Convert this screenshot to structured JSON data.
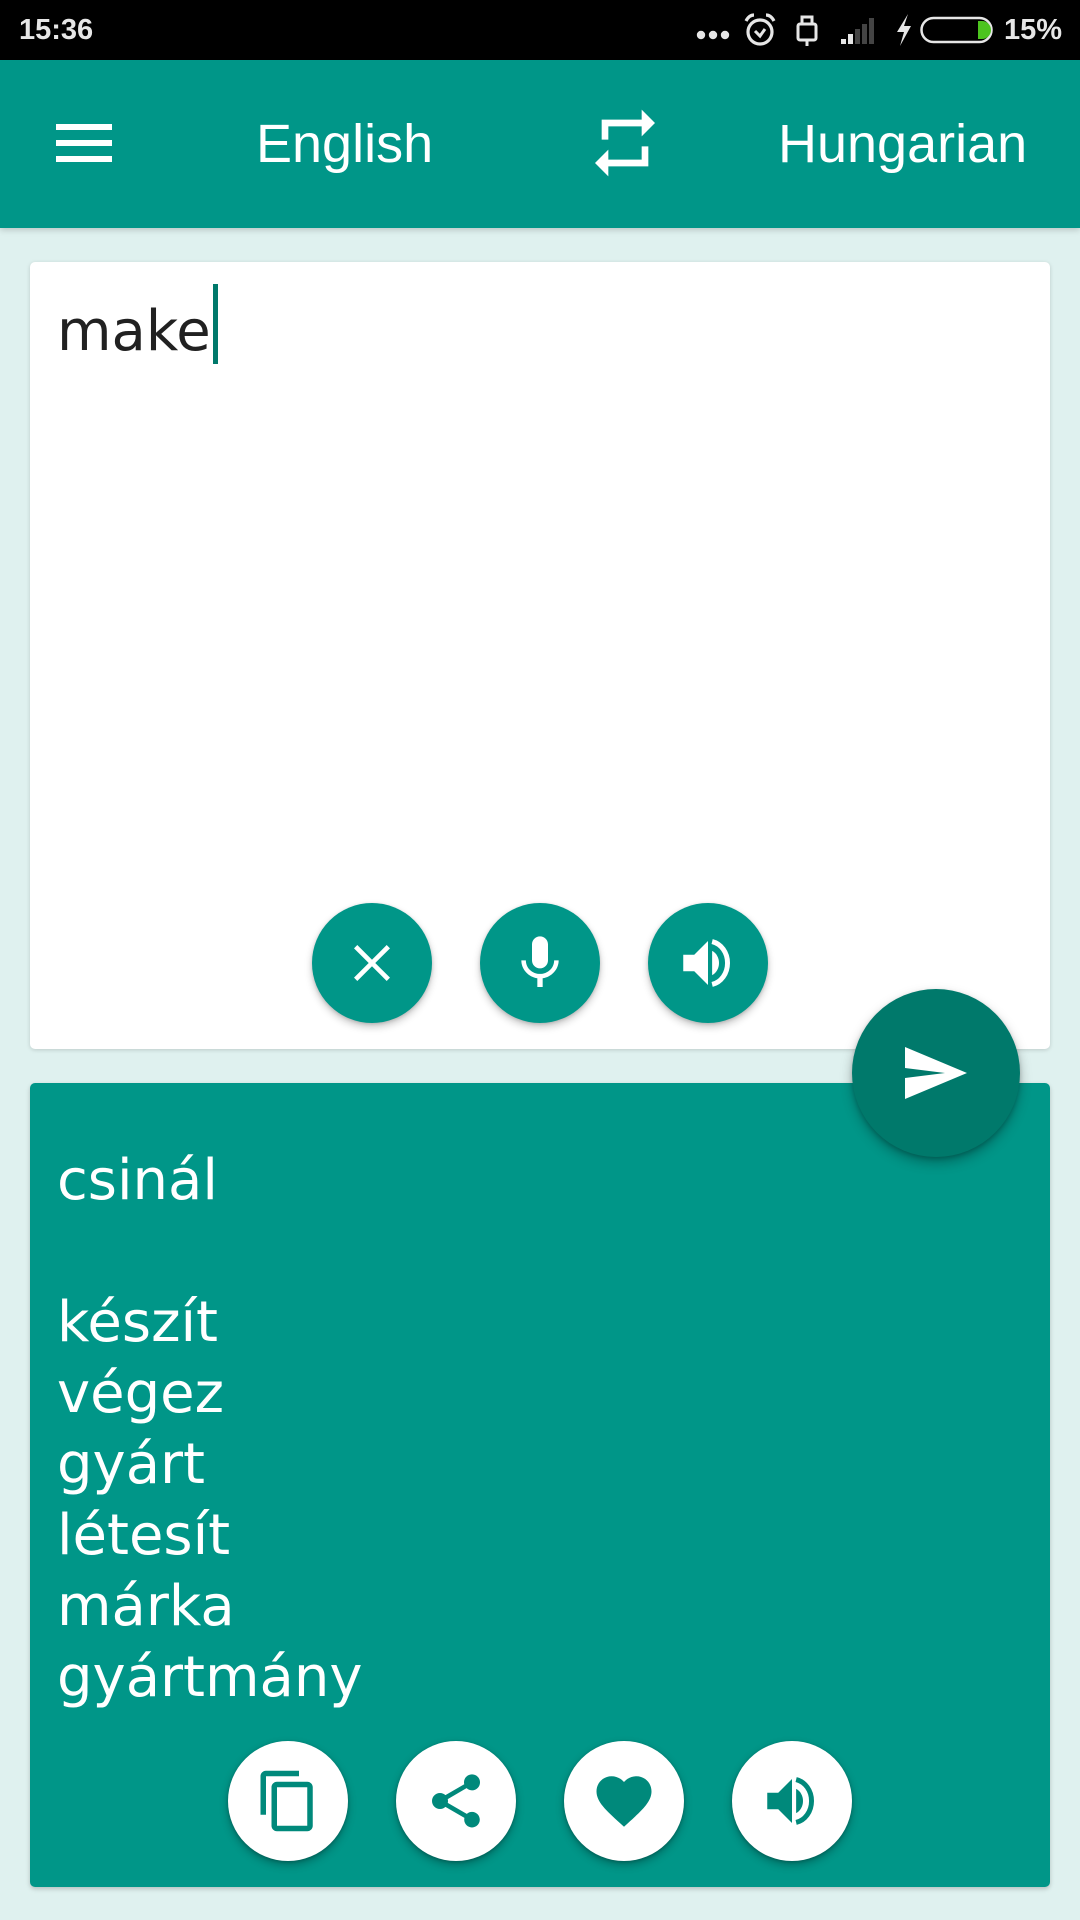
{
  "status_bar": {
    "time": "15:36",
    "battery_percent": "15%",
    "battery_level": 0.15,
    "icons": [
      "more-notifications-icon",
      "alarm-icon",
      "usb-icon",
      "signal-icon",
      "charging-icon",
      "battery-icon"
    ]
  },
  "app_bar": {
    "menu_icon": "hamburger-menu-icon",
    "source_language": "English",
    "swap_icon": "swap-languages-icon",
    "target_language": "Hungarian"
  },
  "input": {
    "value": "make",
    "actions": [
      {
        "name": "clear",
        "icon": "close-icon"
      },
      {
        "name": "voice-input",
        "icon": "microphone-icon"
      },
      {
        "name": "speak-input",
        "icon": "speaker-icon"
      }
    ]
  },
  "translate_button": {
    "icon": "send-icon"
  },
  "output": {
    "lines": [
      "csinál",
      "",
      "készít",
      "végez",
      "gyárt",
      "létesít",
      "márka",
      "gyártmány"
    ],
    "actions": [
      {
        "name": "copy",
        "icon": "copy-icon"
      },
      {
        "name": "share",
        "icon": "share-icon"
      },
      {
        "name": "favorite",
        "icon": "heart-icon"
      },
      {
        "name": "speak-output",
        "icon": "speaker-icon"
      }
    ]
  },
  "colors": {
    "primary": "#009688",
    "primary_dark": "#00796b",
    "background": "#dff1ef",
    "card": "#ffffff",
    "text": "#212121",
    "battery_fill": "#4cc41f"
  }
}
